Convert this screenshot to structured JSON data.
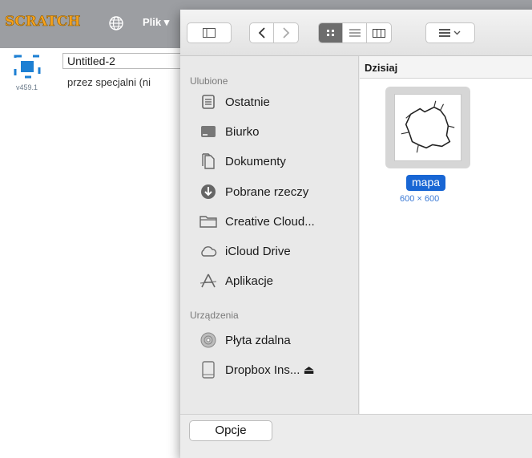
{
  "scratch": {
    "logo": "SCRATCH",
    "menu_file": "Plik",
    "project_title": "Untitled-2",
    "author": "przez specjalni (ni",
    "version": "v459.1"
  },
  "toolbar": {
    "icons": [
      "sidebar-toggle-icon",
      "back-arrow-icon",
      "forward-arrow-icon",
      "icon-view-icon",
      "list-view-icon",
      "column-view-icon",
      "group-menu-icon"
    ]
  },
  "sidebar": {
    "favorites_header": "Ulubione",
    "favorites": [
      {
        "label": "Ostatnie",
        "icon": "recents-icon"
      },
      {
        "label": "Biurko",
        "icon": "desktop-icon"
      },
      {
        "label": "Dokumenty",
        "icon": "documents-icon"
      },
      {
        "label": "Pobrane rzeczy",
        "icon": "downloads-icon"
      },
      {
        "label": "Creative Cloud...",
        "icon": "folder-icon"
      },
      {
        "label": "iCloud Drive",
        "icon": "cloud-icon"
      },
      {
        "label": "Aplikacje",
        "icon": "applications-icon"
      }
    ],
    "devices_header": "Urządzenia",
    "devices": [
      {
        "label": "Płyta zdalna",
        "icon": "disc-icon"
      },
      {
        "label": "Dropbox Ins... ⏏",
        "icon": "drive-icon"
      }
    ]
  },
  "content": {
    "column_header": "Dzisiaj",
    "file": {
      "name": "mapa",
      "dimensions": "600 × 600"
    }
  },
  "bottom": {
    "options_button": "Opcje"
  },
  "colors": {
    "selection": "#1866d4",
    "scratch_bar": "#9c9ea2",
    "scratch_logo": "#f7a21b"
  }
}
